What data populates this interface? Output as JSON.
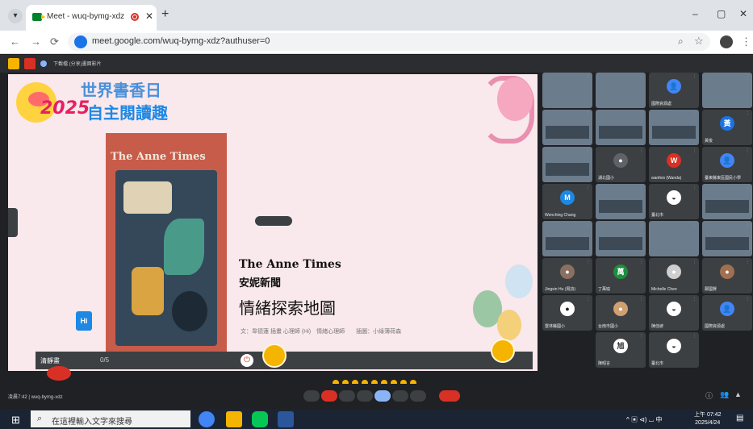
{
  "browser": {
    "tab_title": "Meet - wuq-bymg-xdz",
    "tab_close": "✕",
    "new_tab": "+",
    "window_controls": [
      "–",
      "▢",
      "✕"
    ],
    "url": "meet.google.com/wuq-bymg-xdz?authuser=0",
    "nav": [
      "←",
      "→",
      "⟳"
    ],
    "zoom_icon": "⌕",
    "star": "☆",
    "menu": "⋮"
  },
  "meeting_bar": {
    "label": "下載檔 (分享)畫面影片"
  },
  "slide": {
    "year": "2025",
    "event_title": "世界書香日",
    "event_subtitle": "自主閱讀趣",
    "book_cover_title": "The Anne Times",
    "publisher_logo": "Hi",
    "title_en": "The Anne Times",
    "title_zh": "安妮新聞",
    "heading": "情緒探索地圖",
    "credit": "文：韋德蓮 插畫 心理師 (Hi)　情緒心理師　　插圖：小綠薄荷森"
  },
  "presentation_bar": {
    "label": "清靜畫",
    "counter": "0/5"
  },
  "participants": [
    {
      "name": "",
      "type": "video"
    },
    {
      "name": "",
      "type": "video"
    },
    {
      "name": "國際資源處",
      "type": "avatar",
      "initial": "👤",
      "color": "#4285f4"
    },
    {
      "name": "",
      "type": "video"
    },
    {
      "name": "",
      "type": "room"
    },
    {
      "name": "",
      "type": "room"
    },
    {
      "name": "",
      "type": "room"
    },
    {
      "name": "黃俊",
      "type": "avatar",
      "initial": "黃",
      "color": "#1a73e8"
    },
    {
      "name": "",
      "type": "room"
    },
    {
      "name": "湖北國小",
      "type": "avatar",
      "initial": "●",
      "color": "#5f6368"
    },
    {
      "name": "wanfeis (Wanda)",
      "type": "avatar",
      "initial": "W",
      "color": "#d93025"
    },
    {
      "name": "臺東縣東區國民小學",
      "type": "avatar",
      "initial": "👤",
      "color": "#4285f4"
    },
    {
      "name": "Wenching Chang",
      "type": "avatar",
      "initial": "M",
      "color": "#1e88e5"
    },
    {
      "name": "",
      "type": "room"
    },
    {
      "name": "臺北市",
      "type": "avatar",
      "initial": "◒",
      "color": "#fff"
    },
    {
      "name": "",
      "type": "room"
    },
    {
      "name": "",
      "type": "room"
    },
    {
      "name": "",
      "type": "room"
    },
    {
      "name": "",
      "type": "video"
    },
    {
      "name": "",
      "type": "room"
    },
    {
      "name": "Jingxin Hu (周詩)",
      "type": "avatar",
      "initial": "●",
      "color": "#8a7060"
    },
    {
      "name": "丁萬瑜",
      "type": "avatar",
      "initial": "萬",
      "color": "#1e8e3e"
    },
    {
      "name": "Michelle Chen",
      "type": "avatar",
      "initial": "●",
      "color": "#cfcfcf"
    },
    {
      "name": "鄭國賢",
      "type": "avatar",
      "initial": "●",
      "color": "#a07050"
    },
    {
      "name": "雲林縣國小",
      "type": "avatar",
      "initial": "●",
      "color": "#fff"
    },
    {
      "name": "台南市國小",
      "type": "avatar",
      "initial": "●",
      "color": "#d0a070"
    },
    {
      "name": "陳佳諺",
      "type": "avatar",
      "initial": "◒",
      "color": "#fff"
    },
    {
      "name": "國際資源處",
      "type": "avatar",
      "initial": "👤",
      "color": "#4285f4"
    },
    {
      "name": "陳昭言",
      "type": "avatar",
      "initial": "旭",
      "color": "#fff"
    },
    {
      "name": "臺北市",
      "type": "avatar",
      "initial": "◒",
      "color": "#fff"
    }
  ],
  "controls": {
    "meeting_code": "凌晨7:42 | wuq-bymg-xdz"
  },
  "taskbar": {
    "start": "⊞",
    "search_placeholder": "在這裡輸入文字來搜尋",
    "search_icon": "⌕",
    "tray_text": "^  ▣  ⊲)  ⌴  中",
    "time": "上午 07:42",
    "date": "2025/4/24"
  },
  "colors": {
    "accent": "#1a73e8",
    "end_call": "#d93025",
    "slide_bg": "#f9e8ec"
  }
}
